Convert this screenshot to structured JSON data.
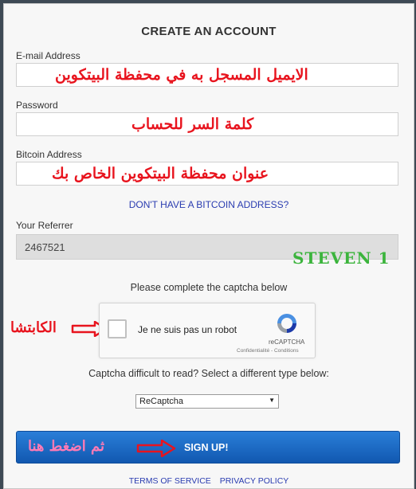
{
  "form": {
    "title": "CREATE AN ACCOUNT",
    "email_label": "E-mail Address",
    "email_annotation": "الايميل المسجل به في محفظة البيتكوين",
    "password_label": "Password",
    "password_annotation": "كلمة السر للحساب",
    "bitcoin_label": "Bitcoin Address",
    "bitcoin_annotation": "عنوان محفظة البيتكوين الخاص بك",
    "no_bitcoin_link": "DON'T HAVE A BITCOIN ADDRESS?",
    "referrer_label": "Your Referrer",
    "referrer_value": "2467521",
    "referrer_annotation": "STEVEN 1",
    "captcha_prompt": "Please complete the captcha below",
    "captcha_annotation": "الكابتشا",
    "captcha_checkbox_text": "Je ne suis pas un robot",
    "captcha_brand": "reCAPTCHA",
    "captcha_links": "Confidentialité - Conditions",
    "captcha_alt_prompt": "Captcha difficult to read? Select a different type below:",
    "captcha_type_selected": "ReCaptcha",
    "signup_label": "SIGN UP!",
    "signup_annotation": "ثم اضغط هنا"
  },
  "footer": {
    "terms": "TERMS OF SERVICE",
    "privacy": "PRIVACY POLICY"
  },
  "colors": {
    "annotation_red": "#e8141e",
    "annotation_green": "#3bb43c",
    "annotation_pink": "#ff7ab5",
    "link_blue": "#2a3cb0",
    "button_blue": "#1a6cc8"
  }
}
